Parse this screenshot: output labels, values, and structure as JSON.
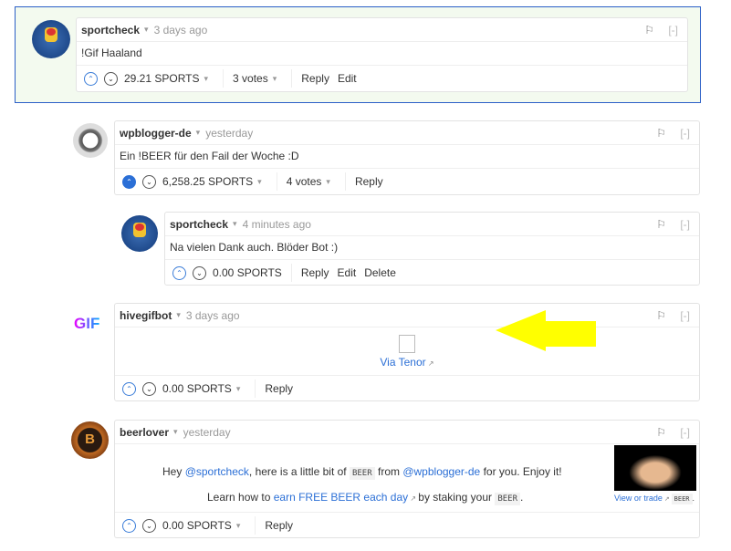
{
  "comments": [
    {
      "author": "sportcheck",
      "time": "3 days ago",
      "text": "!Gif Haaland",
      "payout": "29.21 SPORTS",
      "votes": "3 votes",
      "actions": [
        "Reply",
        "Edit"
      ]
    },
    {
      "author": "wpblogger-de",
      "time": "yesterday",
      "text": "Ein !BEER für den Fail der Woche :D",
      "payout": "6,258.25 SPORTS",
      "votes": "4 votes",
      "actions": [
        "Reply"
      ]
    },
    {
      "author": "sportcheck",
      "time": "4 minutes ago",
      "text": "Na vielen Dank auch. Blöder Bot :)",
      "payout": "0.00 SPORTS",
      "actions": [
        "Reply",
        "Edit",
        "Delete"
      ]
    },
    {
      "author": "hivegifbot",
      "time": "3 days ago",
      "logo_text": "GIF",
      "link": "Via Tenor",
      "payout": "0.00 SPORTS",
      "actions": [
        "Reply"
      ]
    },
    {
      "author": "beerlover",
      "time": "yesterday",
      "payout": "0.00 SPORTS",
      "actions": [
        "Reply"
      ],
      "line1": {
        "a": "Hey ",
        "m1": "@sportcheck",
        "b": ", here is a little bit of ",
        "code": "BEER",
        "c": " from ",
        "m2": "@wpblogger-de",
        "d": " for you. Enjoy it!"
      },
      "line2": {
        "a": "Learn how to ",
        "link": "earn FREE BEER each day",
        "b": " by staking your ",
        "code": "BEER",
        "c": "."
      },
      "trade": {
        "link": "View or trade",
        "code": "BEER",
        "dot": "."
      }
    }
  ],
  "common": {
    "flag": "⚐",
    "collapse": "[-]",
    "caret": "▾",
    "up": "⌃",
    "down": "⌄"
  },
  "colors": {
    "accent": "#2b6fd6",
    "highlight_border": "#2b5fc7",
    "highlight_bg": "#f3faef",
    "arrow": "#ffff00"
  }
}
